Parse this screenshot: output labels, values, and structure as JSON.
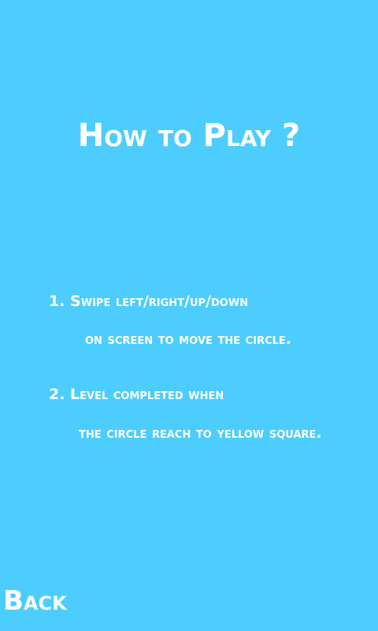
{
  "screen": {
    "title": "How to Play ?",
    "instructions": [
      {
        "line1": "1. Swipe left/right/up/down",
        "line2": "on screen to move the circle."
      },
      {
        "line1": "2. Level completed when",
        "line2": "the circle reach to yellow square."
      }
    ],
    "back_label": "Back"
  },
  "colors": {
    "background": "#4ccdfd",
    "text": "#ffffff"
  }
}
